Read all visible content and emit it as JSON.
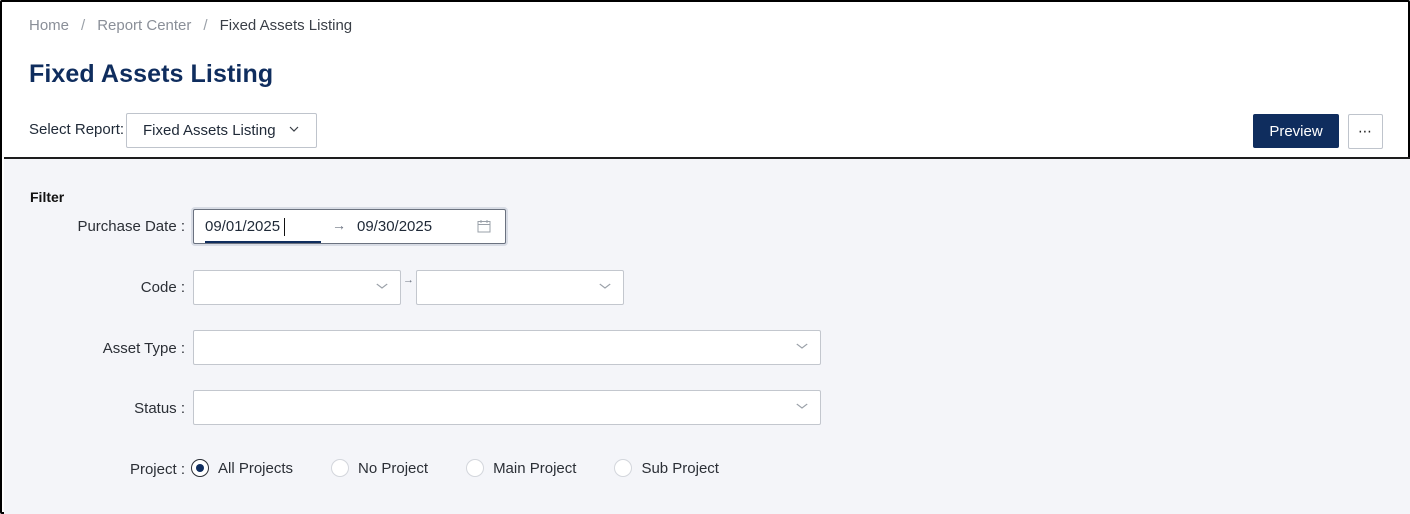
{
  "breadcrumb": {
    "items": [
      "Home",
      "Report Center",
      "Fixed Assets Listing"
    ],
    "separator": "/"
  },
  "page": {
    "title": "Fixed Assets Listing"
  },
  "report_selector": {
    "label": "Select Report:",
    "value": "Fixed Assets Listing",
    "chevron": "chevron-down-icon"
  },
  "actions": {
    "preview_label": "Preview",
    "more_label": "⋯"
  },
  "filter": {
    "heading": "Filter",
    "purchase_date": {
      "label": "Purchase Date :",
      "start": "09/01/2025",
      "end": "09/30/2025",
      "arrow": "→",
      "icon": "calendar-icon"
    },
    "code": {
      "label": "Code :",
      "from_value": "",
      "to_value": "",
      "arrow": "→"
    },
    "asset_type": {
      "label": "Asset Type :",
      "value": ""
    },
    "status": {
      "label": "Status :",
      "value": ""
    },
    "project": {
      "label": "Project :",
      "options": [
        {
          "label": "All Projects",
          "selected": true
        },
        {
          "label": "No Project",
          "selected": false
        },
        {
          "label": "Main Project",
          "selected": false
        },
        {
          "label": "Sub Project",
          "selected": false
        }
      ]
    }
  },
  "colors": {
    "brand": "#0f2d5e",
    "panel_bg": "#f4f5f9",
    "muted_text": "#8a8f98"
  }
}
